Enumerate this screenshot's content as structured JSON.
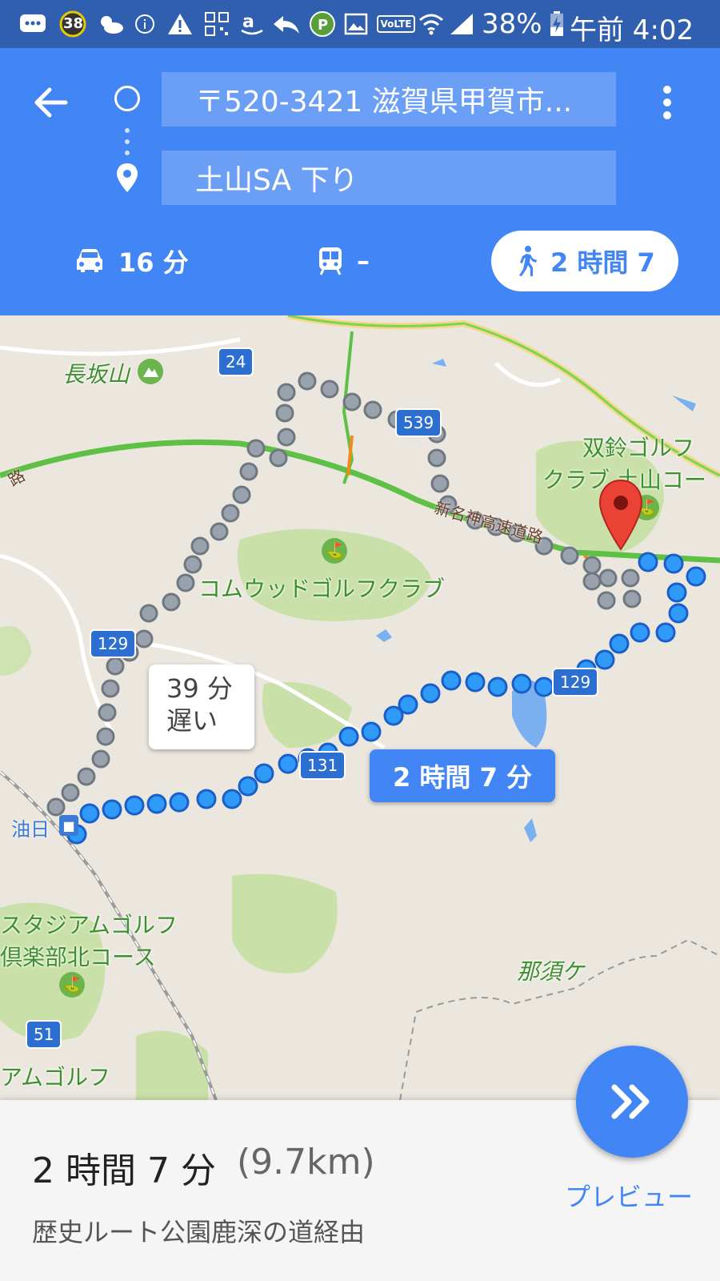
{
  "status_bar": {
    "badge": "38",
    "battery": "38%",
    "time": "午前 4:02",
    "network_label": "VoLTE",
    "icons": [
      "message-icon",
      "badge-icon",
      "weather-icon",
      "info-icon",
      "warning-icon",
      "qr-icon",
      "amazon-icon",
      "reply-icon",
      "app-icon",
      "image-icon",
      "volte-icon",
      "wifi-icon",
      "signal-icon",
      "battery-icon"
    ]
  },
  "header": {
    "origin": "〒520-3421 滋賀県甲賀市...",
    "destination": "土山SA 下り",
    "modes": [
      {
        "name": "car",
        "label": "16 分"
      },
      {
        "name": "transit",
        "label": "–"
      },
      {
        "name": "walk",
        "label": "2 時間 7"
      }
    ],
    "accent": "#4285f4"
  },
  "map": {
    "labels": {
      "mountain": "長坂山",
      "golf1": "双鈴ゴルフ",
      "golf1b": "クラブ 土山コー",
      "golf2": "コムウッドゴルフクラブ",
      "golf3": "スタジアムゴルフ",
      "golf3b": "倶楽部北コース",
      "golf4": "アムゴルフ",
      "expressway": "新名神高速道路",
      "station": "油日",
      "nasu": "那須ケ",
      "road_left": "路"
    },
    "shields": [
      "24",
      "539",
      "129",
      "129",
      "131",
      "51"
    ],
    "alt_callout": {
      "line1": "39 分",
      "line2": "遅い"
    },
    "main_callout": "2 時間 7 分"
  },
  "bottom": {
    "time": "2 時間 7 分",
    "distance": "(9.7km)",
    "via": "歴史ルート公園鹿深の道経由",
    "preview_label": "プレビュー"
  }
}
